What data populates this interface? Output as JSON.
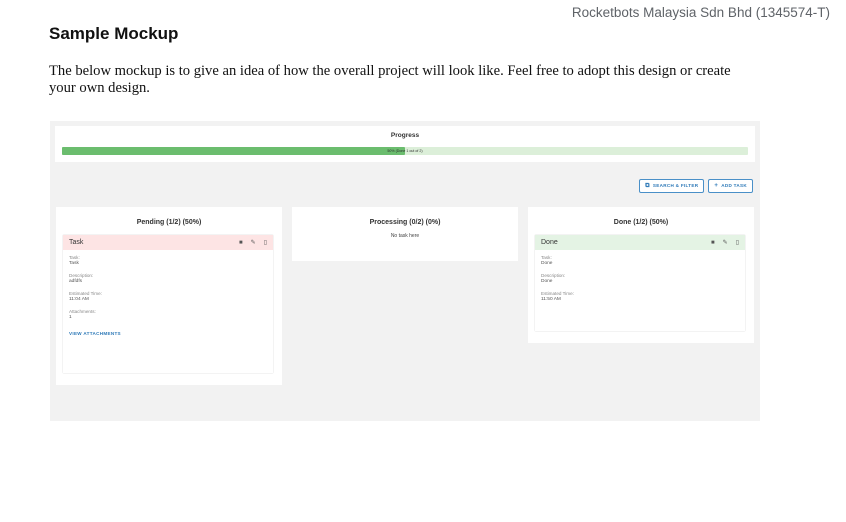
{
  "header": {
    "company": "Rocketbots Malaysia Sdn Bhd (1345574-T)",
    "title": "Sample Mockup",
    "paragraph": "The below mockup is to give an idea of how the overall project will look like. Feel free to adopt this design or create your own design."
  },
  "mockup": {
    "progress": {
      "title": "Progress",
      "percent": 50,
      "text": "50% (Done 1 out of 2)"
    },
    "toolbar": {
      "search_filter_label": "SEARCH & FILTER",
      "search_filter_icon": "filter-icon",
      "add_task_label": "ADD TASK",
      "add_task_icon": "plus-icon"
    },
    "columns": {
      "pending": {
        "title": "Pending (1/2) (50%)",
        "task": {
          "name": "Task",
          "task_label": "Task:",
          "task_value": "Task",
          "description_label": "Description:",
          "description_value": "adfdfs",
          "time_label": "Estimated Time:",
          "time_value": "11:04 AM",
          "attachments_label": "Attachments:",
          "attachments_value": "1",
          "view_attachments": "VIEW ATTACHMENTS"
        }
      },
      "processing": {
        "title": "Processing (0/2) (0%)",
        "empty": "No task here"
      },
      "done": {
        "title": "Done (1/2) (50%)",
        "task": {
          "name": "Done",
          "task_label": "Task:",
          "task_value": "Done",
          "description_label": "Description:",
          "description_value": "Done",
          "time_label": "Estimated Time:",
          "time_value": "11:50 AM"
        }
      }
    },
    "icons": {
      "move": "move-icon",
      "edit": "pencil-icon",
      "delete": "trash-icon"
    }
  }
}
